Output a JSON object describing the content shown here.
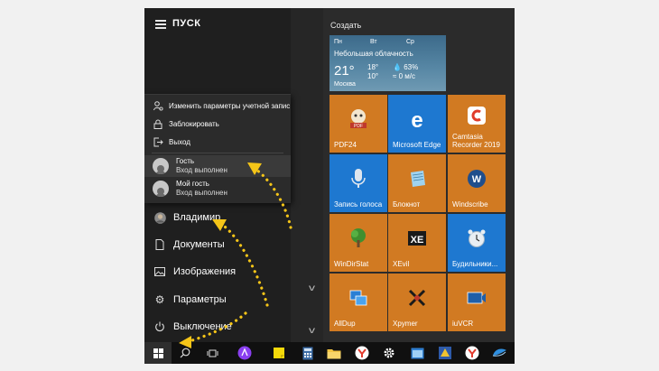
{
  "start": {
    "title": "ПУСК",
    "section_label": "Создать"
  },
  "account_menu": {
    "items": [
      {
        "label": "Изменить параметры учетной запис",
        "icon": "person-settings-icon"
      },
      {
        "label": "Заблокировать",
        "icon": "lock-icon"
      },
      {
        "label": "Выход",
        "icon": "sign-out-icon"
      }
    ],
    "accounts": [
      {
        "name": "Гость",
        "status": "Вход выполнен"
      },
      {
        "name": "Мой гость",
        "status": "Вход выполнен"
      }
    ]
  },
  "nav": {
    "user": "Владимир",
    "documents": "Документы",
    "pictures": "Изображения",
    "settings": "Параметры",
    "power": "Выключение"
  },
  "weather": {
    "days": [
      "Пн",
      "Вт",
      "Ср"
    ],
    "condition": "Небольшая облачность",
    "temp": "21°",
    "city": "Москва",
    "hi": "18°",
    "lo": "10°",
    "humidity": "63%",
    "wind": "0 м/с"
  },
  "tiles": [
    {
      "label": "PDF24",
      "color": "#d17a22",
      "icon": "pdf24-icon"
    },
    {
      "label": "Microsoft Edge",
      "color": "#1e78d0",
      "icon": "edge-icon"
    },
    {
      "label": "Camtasia Recorder 2019",
      "color": "#d17a22",
      "icon": "camtasia-icon"
    },
    {
      "label": "Запись голоса",
      "color": "#1e78d0",
      "icon": "microphone-icon"
    },
    {
      "label": "Блокнот",
      "color": "#d17a22",
      "icon": "notepad-icon"
    },
    {
      "label": "Windscribe",
      "color": "#d17a22",
      "icon": "windscribe-icon"
    },
    {
      "label": "WinDirStat",
      "color": "#d17a22",
      "icon": "windirstat-icon"
    },
    {
      "label": "XEvil",
      "color": "#d17a22",
      "icon": "xevil-icon"
    },
    {
      "label": "Будильники...",
      "color": "#1e78d0",
      "icon": "alarm-clock-icon"
    },
    {
      "label": "AllDup",
      "color": "#d17a22",
      "icon": "alldup-icon"
    },
    {
      "label": "Xpymer",
      "color": "#d17a22",
      "icon": "xpymer-icon"
    },
    {
      "label": "iuVCR",
      "color": "#d17a22",
      "icon": "iuvcr-icon"
    }
  ],
  "colors": {
    "accent_orange": "#d17a22",
    "accent_blue": "#1e78d0",
    "arrow_yellow": "#f5c518",
    "menu_bg": "#2b2b2b"
  }
}
